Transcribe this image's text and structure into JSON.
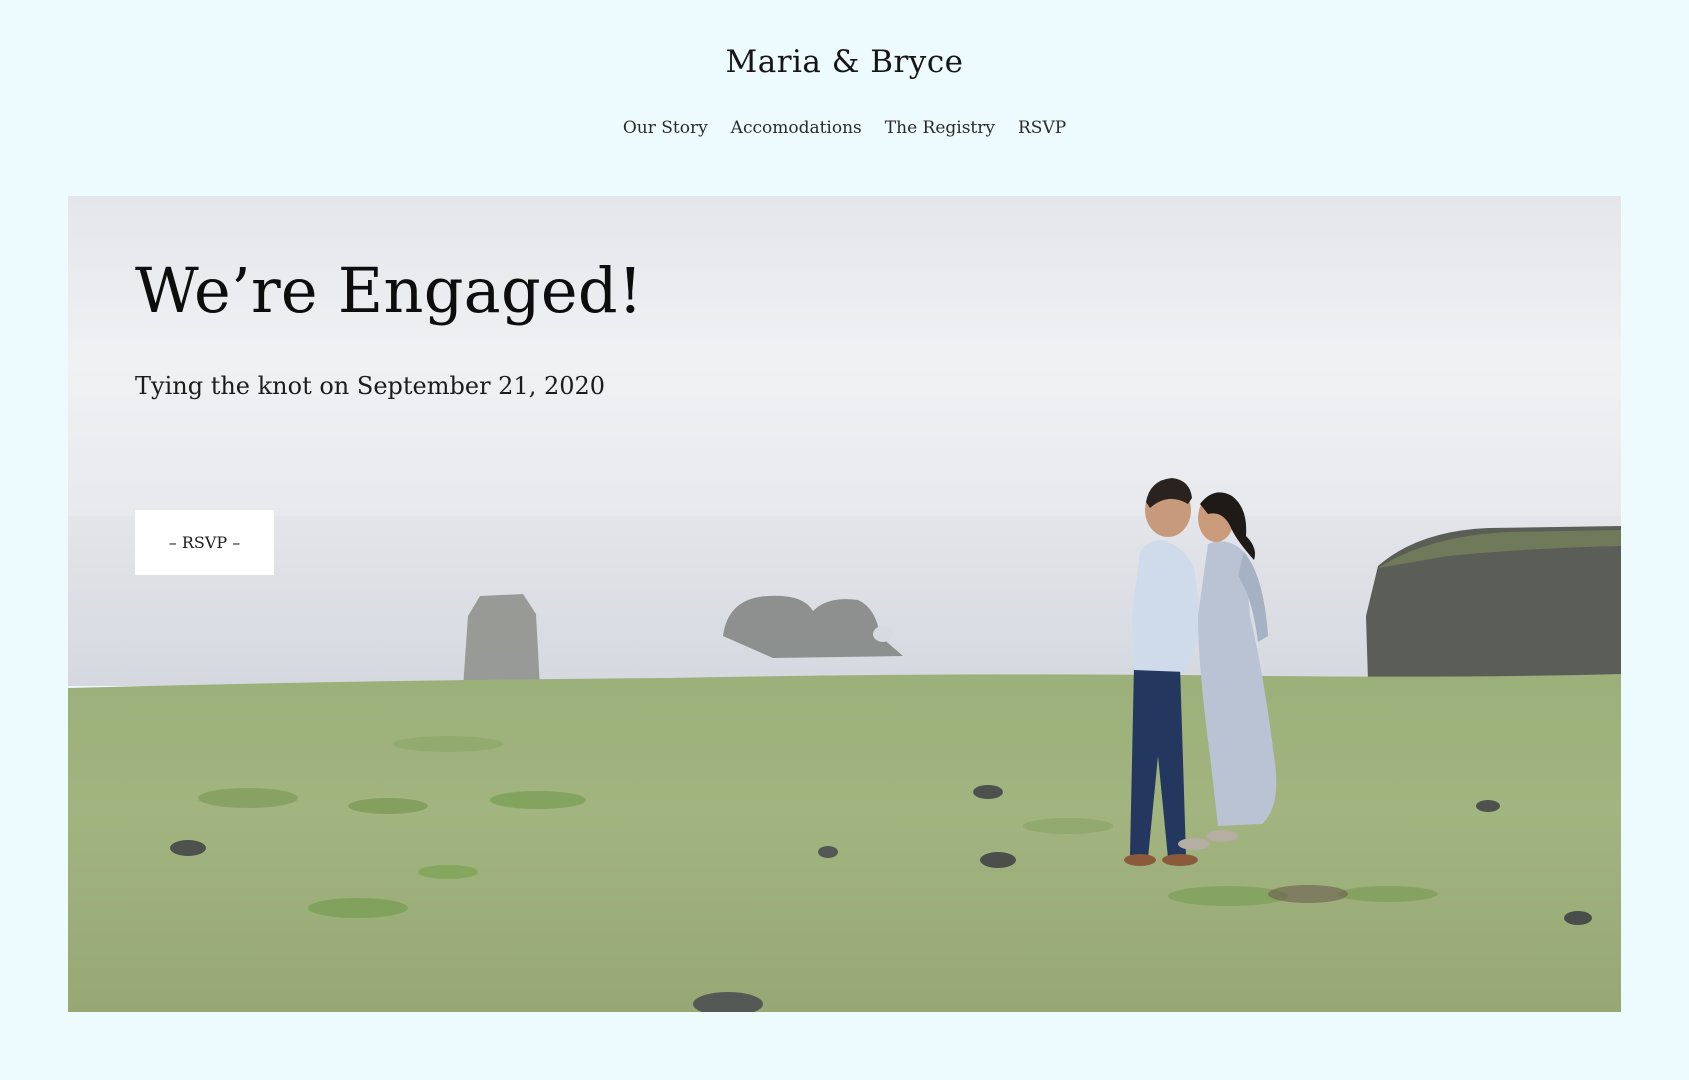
{
  "site": {
    "title": "Maria & Bryce"
  },
  "nav": {
    "items": [
      {
        "label": "Our Story"
      },
      {
        "label": "Accomodations"
      },
      {
        "label": "The Registry"
      },
      {
        "label": "RSVP"
      }
    ]
  },
  "hero": {
    "headline": "We’re Engaged!",
    "subline": "Tying the knot on September 21, 2020",
    "rsvp_button_label": "– RSVP –"
  },
  "colors": {
    "page_background": "#eefbfe",
    "button_background": "#ffffff",
    "text": "#0d0d0d"
  }
}
